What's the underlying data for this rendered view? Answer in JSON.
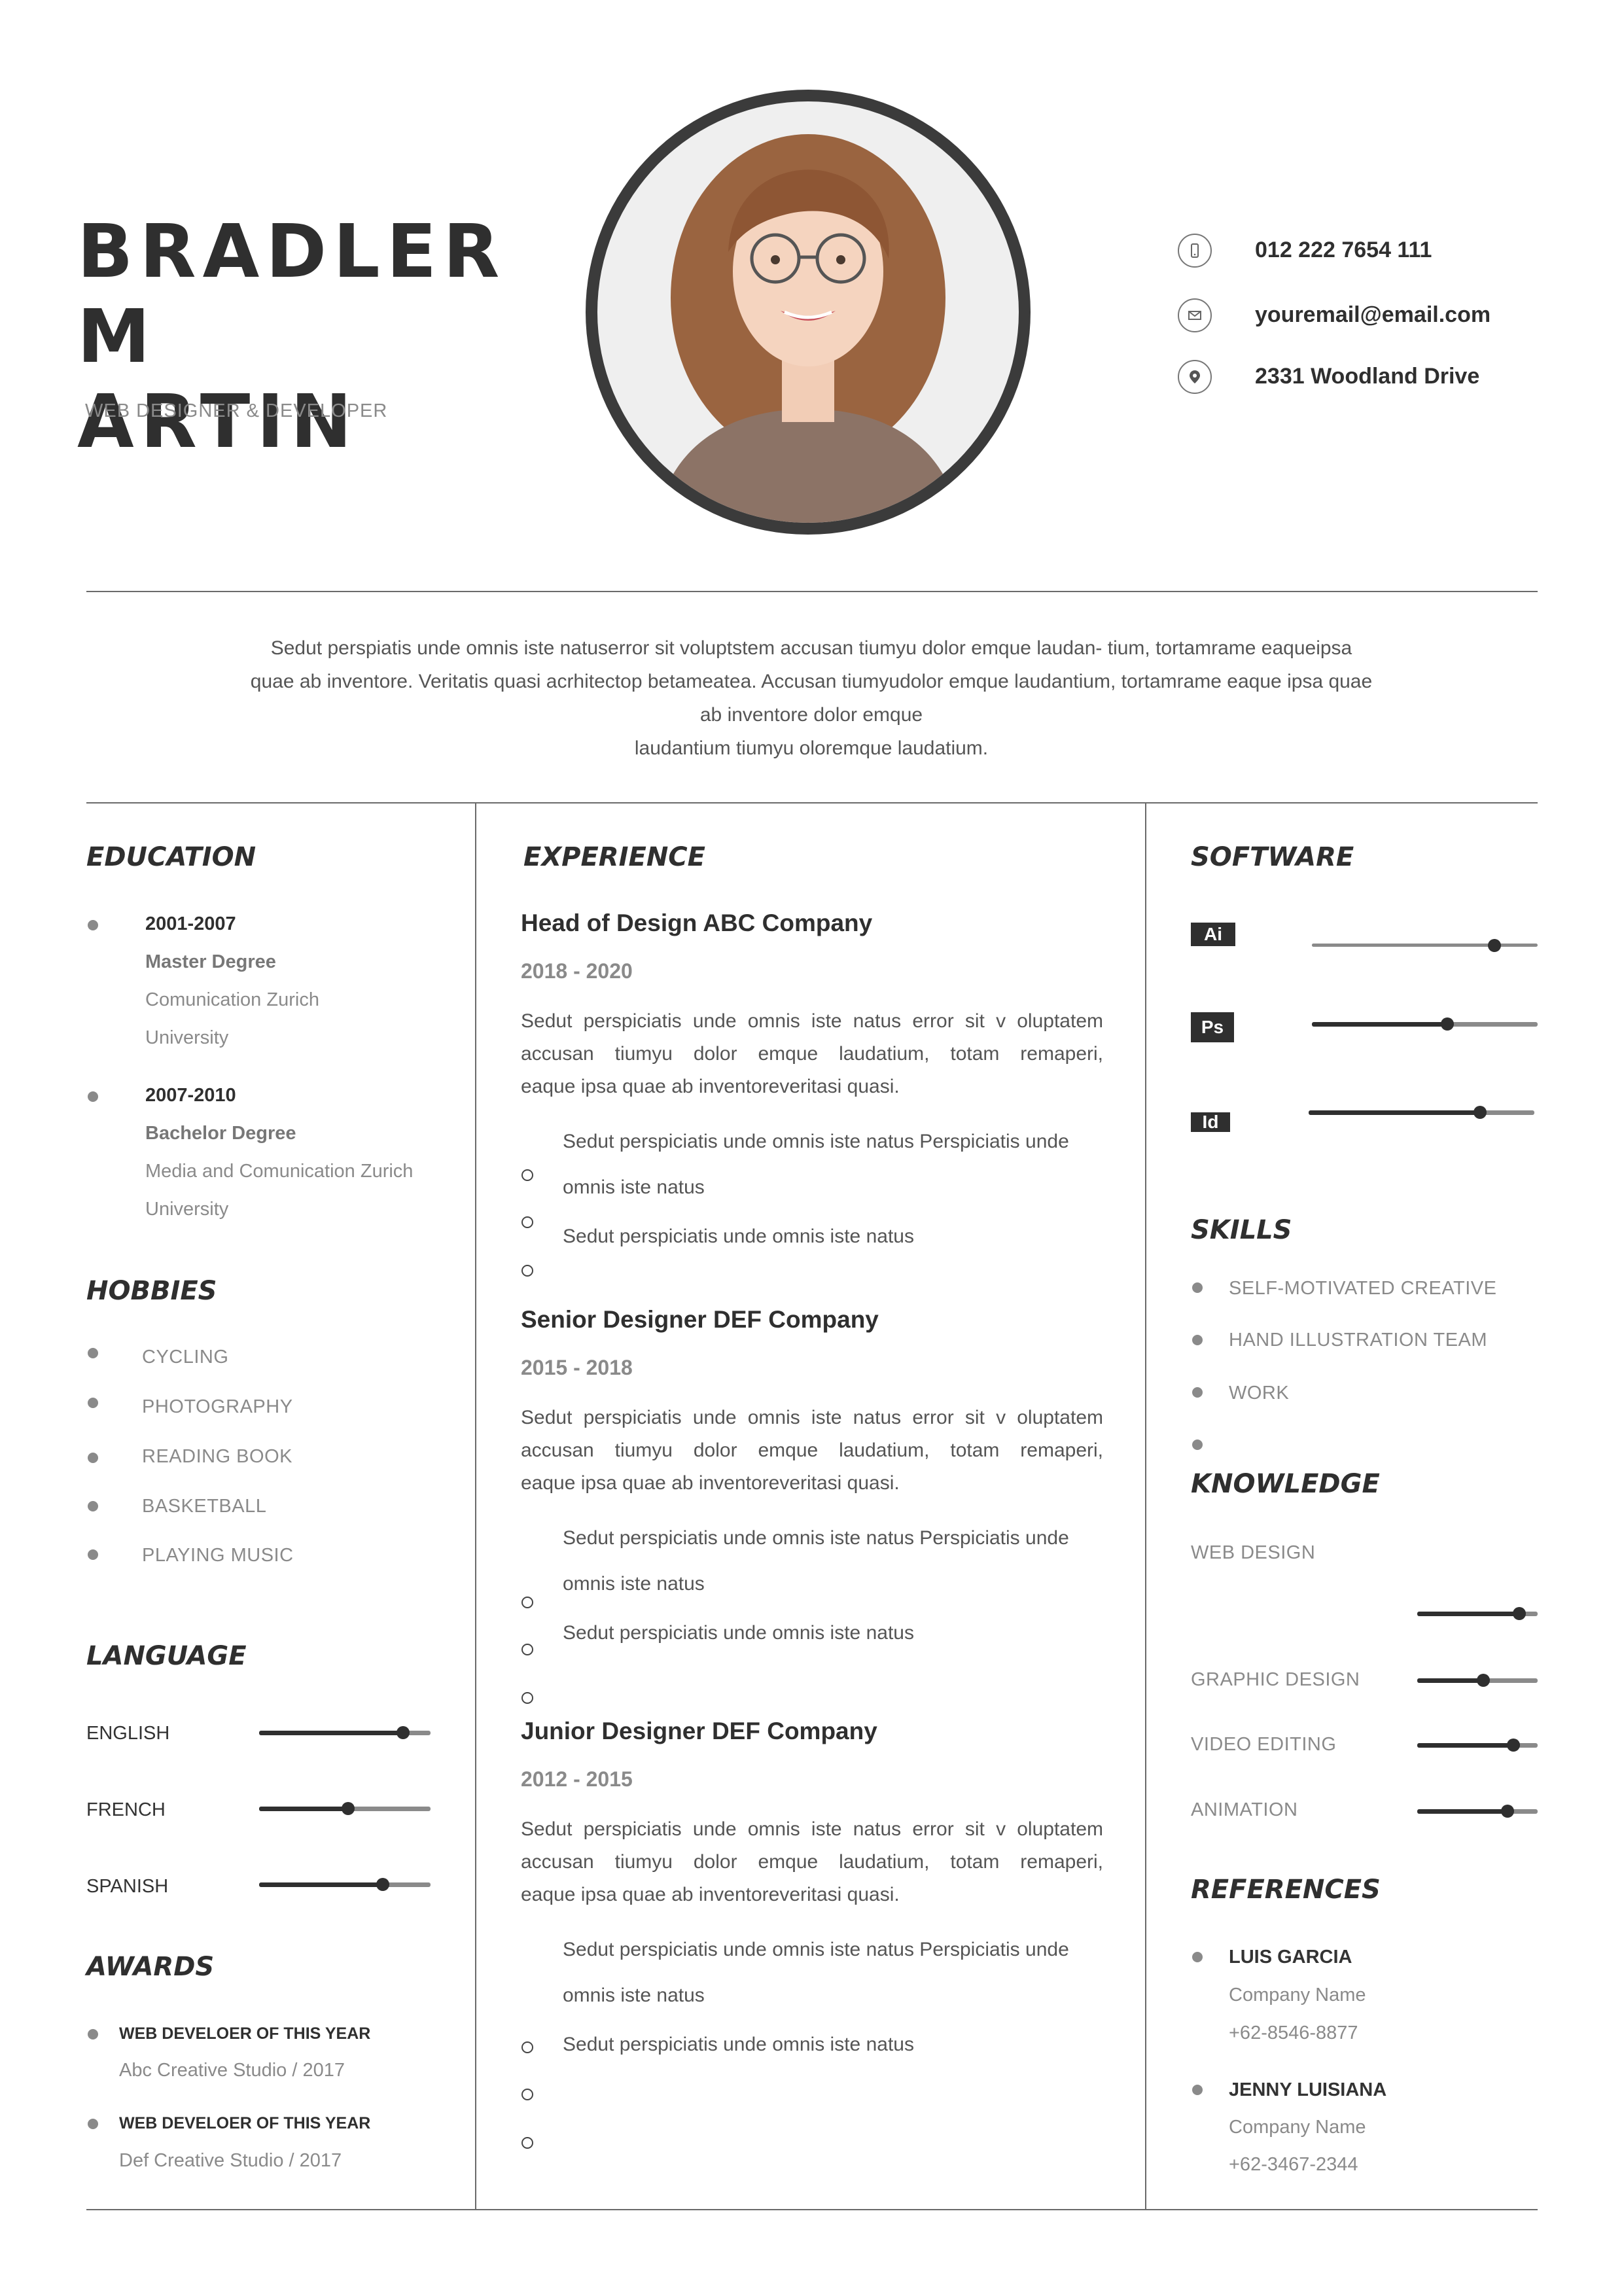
{
  "header": {
    "name_line1": "BRADLER M",
    "name_line2": "ARTIN",
    "subtitle": "WEB DESIGNER & DEVELOPER"
  },
  "contact": {
    "phone": "012 222 7654 111",
    "email": "youremail@email.com",
    "address": "2331 Woodland Drive",
    "icons": [
      "phone-icon",
      "mail-icon",
      "location-pin-icon"
    ]
  },
  "summary": {
    "lines": [
      "Sedut perspiatis unde omnis iste natuserror sit voluptstem accusan tiumyu dolor emque laudan- tium, tortamrame eaqueipsa",
      "quae ab inventore. Veritatis quasi acrhitectop betameatea. Accusan tiumyudolor emque laudantium, tortamrame eaque ipsa quae",
      "ab inventore dolor emque",
      "laudantium tiumyu oloremque laudatium."
    ]
  },
  "education": {
    "title": "EDUCATION",
    "items": [
      {
        "years": "2001-2007",
        "degree": "Master Degree",
        "school_line1": "Comunication Zurich",
        "school_line2": "University"
      },
      {
        "years": "2007-2010",
        "degree": "Bachelor Degree",
        "school_line1": "Media and Comunication Zurich",
        "school_line2": "University"
      }
    ]
  },
  "hobbies": {
    "title": "HOBBIES",
    "items": [
      "CYCLING",
      "PHOTOGRAPHY",
      "READING BOOK",
      "BASKETBALL",
      "PLAYING MUSIC"
    ]
  },
  "language": {
    "title": "LANGUAGE",
    "items": [
      {
        "name": "ENGLISH",
        "level": 0.84
      },
      {
        "name": "FRENCH",
        "level": 0.52
      },
      {
        "name": "SPANISH",
        "level": 0.72
      }
    ]
  },
  "awards": {
    "title": "AWARDS",
    "items": [
      {
        "title": "WEB DEVELOER OF THIS YEAR",
        "detail": "Abc Creative Studio / 2017"
      },
      {
        "title": "WEB DEVELOER OF THIS YEAR",
        "detail": "Def Creative Studio / 2017"
      }
    ]
  },
  "experience": {
    "title": "EXPERIENCE",
    "jobs": [
      {
        "title": "Head of Design ABC Company",
        "years": "2018 - 2020",
        "desc_lines": [
          "Sedut perspiciatis unde omnis iste natus error sit v oluptatem",
          "accusan tiumyu dolor emque laudatium, totam remaperi,",
          "eaque ipsa quae ab inventoreveritasi quasi."
        ],
        "bullet1_line1": "Sedut perspiciatis unde omnis iste natus Perspiciatis unde",
        "bullet1_line2": "omnis iste natus",
        "bullet2": "Sedut perspiciatis unde omnis iste natus"
      },
      {
        "title": "Senior Designer DEF Company",
        "years": "2015 - 2018",
        "desc_lines": [
          "Sedut perspiciatis unde omnis iste natus error sit v oluptatem",
          "accusan tiumyu dolor emque laudatium, totam remaperi,",
          "eaque ipsa quae ab inventoreveritasi quasi."
        ],
        "bullet1_line1": "Sedut perspiciatis unde omnis iste natus Perspiciatis unde",
        "bullet1_line2": "omnis iste natus",
        "bullet2": "Sedut perspiciatis unde omnis iste natus"
      },
      {
        "title": "Junior Designer DEF Company",
        "years": "2012 - 2015",
        "desc_lines": [
          "Sedut perspiciatis unde omnis iste natus error sit v oluptatem",
          "accusan tiumyu dolor emque laudatium, totam remaperi,",
          "eaque ipsa quae ab inventoreveritasi quasi."
        ],
        "bullet1_line1": "Sedut perspiciatis unde omnis iste natus Perspiciatis unde",
        "bullet1_line2": "omnis iste natus",
        "bullet2": "Sedut perspiciatis unde omnis iste natus"
      }
    ]
  },
  "software": {
    "title": "SOFTWARE",
    "items": [
      {
        "label": "Ai",
        "level": 0.81
      },
      {
        "label": "Ps",
        "level": 0.6
      },
      {
        "label": "Id",
        "level": 0.76
      }
    ]
  },
  "skills": {
    "title": "SKILLS",
    "items": [
      "SELF-MOTIVATED CREATIVE",
      "HAND ILLUSTRATION TEAM",
      "WORK",
      ""
    ]
  },
  "knowledge": {
    "title": "KNOWLEDGE",
    "items": [
      {
        "name": "WEB DESIGN",
        "level": 0.85
      },
      {
        "name": "GRAPHIC DESIGN",
        "level": 0.55
      },
      {
        "name": "VIDEO EDITING",
        "level": 0.8
      },
      {
        "name": "ANIMATION",
        "level": 0.75
      }
    ]
  },
  "references": {
    "title": "REFERENCES",
    "items": [
      {
        "name": "LUIS GARCIA",
        "company": "Company Name",
        "phone": "+62-8546-8877"
      },
      {
        "name": "JENNY LUISIANA",
        "company": "Company Name",
        "phone": "+62-3467-2344"
      }
    ]
  },
  "colors": {
    "dark": "#2f2f2f",
    "gray": "#8a8a8a",
    "rule": "#6a6a6a"
  }
}
